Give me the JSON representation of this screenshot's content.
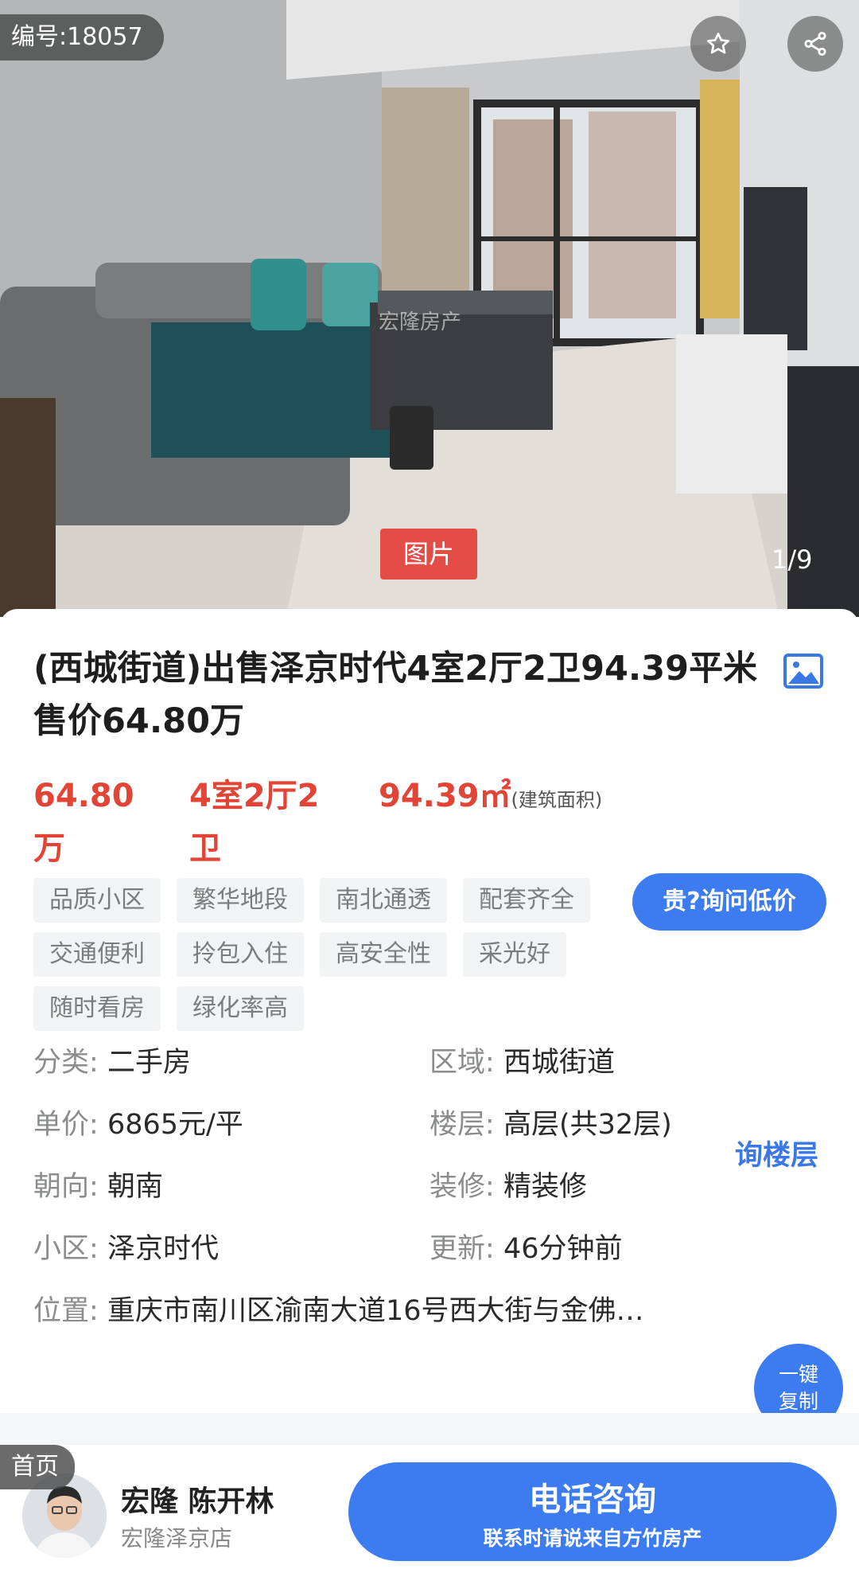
{
  "photo": {
    "listing_id": "编号:18057",
    "watermark": "宏隆房产",
    "type_tag": "图片",
    "pager": "1/9",
    "icons": [
      "star-icon",
      "share-icon"
    ]
  },
  "listing": {
    "title": "(西城街道)出售泽京时代4室2厅2卫94.39平米 售价64.80万",
    "price": "64.80万",
    "layout": "4室2厅2卫",
    "area": "94.39㎡",
    "area_note": "(建筑面积)",
    "tags": [
      "品质小区",
      "繁华地段",
      "南北通透",
      "配套齐全",
      "交通便利",
      "拎包入住",
      "高安全性",
      "采光好",
      "随时看房",
      "绿化率高"
    ],
    "ask_price_button": "贵?询问低价"
  },
  "attributes": {
    "category_label": "分类:",
    "category": "二手房",
    "district_label": "区域:",
    "district": "西城街道",
    "unit_price_label": "单价:",
    "unit_price": "6865元/平",
    "floor_label": "楼层:",
    "floor": "高层(共32层)",
    "floor_link": "询楼层",
    "orientation_label": "朝向:",
    "orientation": "朝南",
    "decoration_label": "装修:",
    "decoration": "精装修",
    "community_label": "小区:",
    "community": "泽京时代",
    "updated_label": "更新:",
    "updated": "46分钟前",
    "location_label": "位置:",
    "location": "重庆市南川区渝南大道16号西大街与金佛…",
    "copy_line1": "一键",
    "copy_line2": "复制"
  },
  "bottom_bar": {
    "home": "首页",
    "agent_name": "宏隆 陈开林",
    "agent_store": "宏隆泽京店",
    "call_title": "电话咨询",
    "call_subtitle": "联系时请说来自方竹房产"
  },
  "colors": {
    "accent_blue": "#3d7cf0",
    "price_red": "#e24436",
    "tag_bg": "#f2f3f5",
    "photo_tag_red": "#e34d46"
  }
}
